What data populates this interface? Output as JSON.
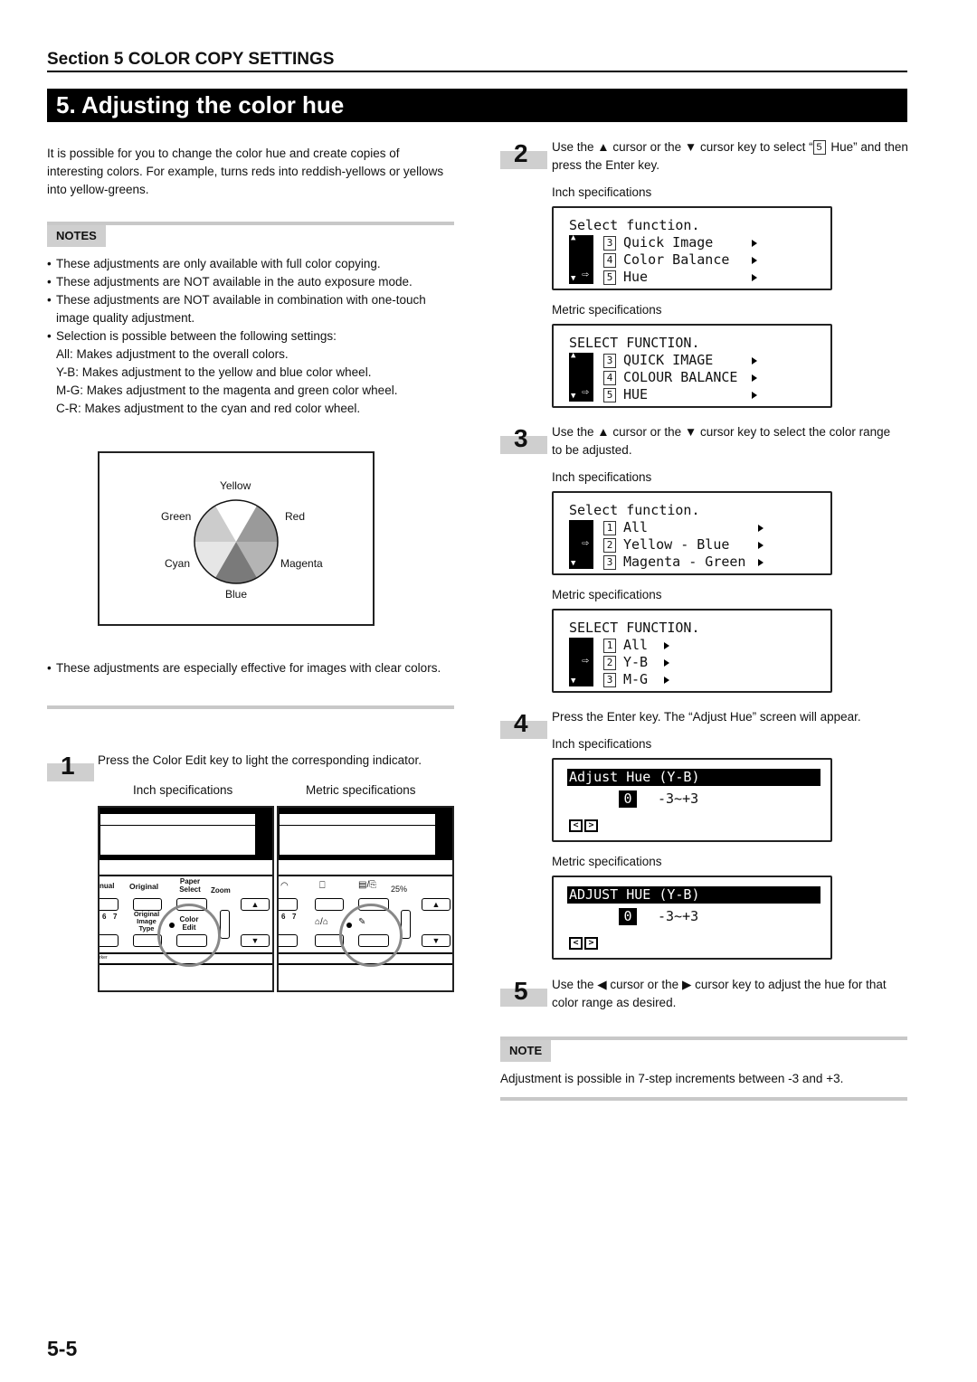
{
  "header": {
    "section": "Section 5  COLOR COPY SETTINGS",
    "title": "5.   Adjusting the color hue"
  },
  "intro": "It is possible for you to change the color hue and create copies of interesting colors. For example, turns reds into reddish-yellows or yellows into yellow-greens.",
  "notes": {
    "label": "NOTES",
    "items": [
      "These adjustments are only available with full color copying.",
      "These adjustments are NOT available in the auto exposure mode.",
      "These adjustments are NOT available in combination with one-touch image quality adjustment.",
      "Selection is possible between the following settings:"
    ],
    "settings": [
      "All: Makes adjustment to the overall colors.",
      "Y-B: Makes adjustment to the yellow and blue color wheel.",
      "M-G: Makes adjustment to the magenta and green color wheel.",
      "C-R: Makes adjustment to the cyan and red color wheel."
    ]
  },
  "color_wheel": {
    "labels": [
      "Yellow",
      "Red",
      "Magenta",
      "Blue",
      "Cyan",
      "Green"
    ],
    "shades": [
      "#ffffff",
      "#9a9a9a",
      "#b4b4b4",
      "#7a7a7a",
      "#e6e6e6",
      "#cccccc"
    ]
  },
  "effective_note": "These adjustments are especially effective for images with clear colors.",
  "steps": [
    {
      "num": "1",
      "text": "Press the Color Edit key to light the corresponding indicator.",
      "inch_label": "Inch specifications",
      "metric_label": "Metric specifications",
      "inch_panel": {
        "keys": [
          "nual",
          "Original",
          "Paper Select",
          "Zoom",
          "(−)",
          "Original Image Type",
          "Color Edit",
          "6",
          "7",
          "rker"
        ]
      },
      "metric_panel": {
        "keys": [
          "25%",
          "6",
          "7"
        ]
      }
    },
    {
      "num": "2",
      "text_pre": "Use the ▲ cursor or the ▼ cursor key to select “",
      "text_key": "5",
      "text_post": " Hue” and then press the Enter key.",
      "inch_label": "Inch specifications",
      "inch_lcd": {
        "title": "Select function.",
        "items": [
          {
            "num": "3",
            "label": "Quick Image"
          },
          {
            "num": "4",
            "label": "Color Balance"
          },
          {
            "num": "5",
            "label": "Hue"
          }
        ]
      },
      "metric_label": "Metric specifications",
      "metric_lcd": {
        "title": "SELECT FUNCTION.",
        "items": [
          {
            "num": "3",
            "label": "QUICK IMAGE"
          },
          {
            "num": "4",
            "label": "COLOUR BALANCE"
          },
          {
            "num": "5",
            "label": "HUE"
          }
        ]
      }
    },
    {
      "num": "3",
      "text": "Use the ▲ cursor or the ▼ cursor key to select the color range to be adjusted.",
      "inch_label": "Inch specifications",
      "inch_lcd": {
        "title": "Select function.",
        "items": [
          {
            "num": "1",
            "label": "All"
          },
          {
            "num": "2",
            "label": "Yellow - Blue"
          },
          {
            "num": "3",
            "label": "Magenta - Green"
          }
        ]
      },
      "metric_label": "Metric specifications",
      "metric_lcd": {
        "title": "SELECT FUNCTION.",
        "items": [
          {
            "num": "1",
            "label": "All"
          },
          {
            "num": "2",
            "label": "Y-B"
          },
          {
            "num": "3",
            "label": "M-G"
          }
        ]
      }
    },
    {
      "num": "4",
      "text": "Press the Enter key. The “Adjust Hue” screen will appear.",
      "inch_label": "Inch specifications",
      "inch_lcd": {
        "title": "Adjust Hue (Y-B)",
        "value": "0",
        "range": "-3~+3"
      },
      "metric_label": "Metric specifications",
      "metric_lcd": {
        "title": "ADJUST HUE (Y-B)",
        "value": "0",
        "range": "-3~+3"
      }
    },
    {
      "num": "5",
      "text": "Use the ◀ cursor or the ▶ cursor key to adjust the hue for that color range as desired."
    }
  ],
  "note": {
    "label": "NOTE",
    "text": "Adjustment is possible in 7-step increments between -3 and +3."
  },
  "page_number": "5-5"
}
